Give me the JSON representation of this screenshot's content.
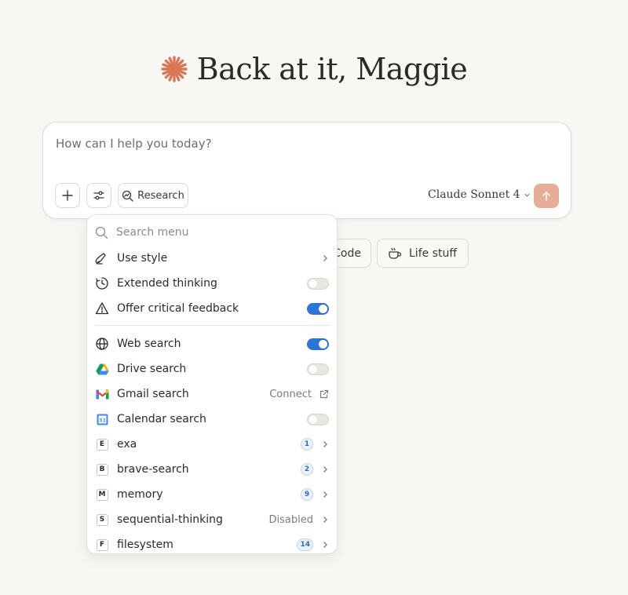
{
  "greeting": {
    "text": "Back at it, Maggie"
  },
  "composer": {
    "prompt": "How can I help you today?",
    "research_label": "Research",
    "model_label": "Claude Sonnet 4"
  },
  "chips": {
    "code": "Code",
    "life": "Life stuff"
  },
  "menu": {
    "search_placeholder": "Search menu",
    "items": [
      {
        "label": "Use style"
      },
      {
        "label": "Extended thinking",
        "toggle": false
      },
      {
        "label": "Offer critical feedback",
        "toggle": true
      },
      {
        "label": "Web search",
        "toggle": true
      },
      {
        "label": "Drive search",
        "toggle": false
      },
      {
        "label": "Gmail search",
        "action": "Connect"
      },
      {
        "label": "Calendar search",
        "toggle": false
      },
      {
        "label": "exa",
        "letter": "E",
        "count": "1"
      },
      {
        "label": "brave-search",
        "letter": "B",
        "count": "2"
      },
      {
        "label": "memory",
        "letter": "M",
        "count": "9"
      },
      {
        "label": "sequential-thinking",
        "letter": "S",
        "status": "Disabled"
      },
      {
        "label": "filesystem",
        "letter": "F",
        "count": "14"
      }
    ]
  },
  "colors": {
    "accent_orange": "#d97757",
    "toggle_on": "#2c74d9",
    "send_button": "#e6ad98",
    "background": "#f8f7f3"
  },
  "icons": {
    "spark": "claude-spark-icon",
    "plus": "plus-icon",
    "sliders": "sliders-icon",
    "research": "research-icon",
    "send": "arrow-up-icon"
  }
}
